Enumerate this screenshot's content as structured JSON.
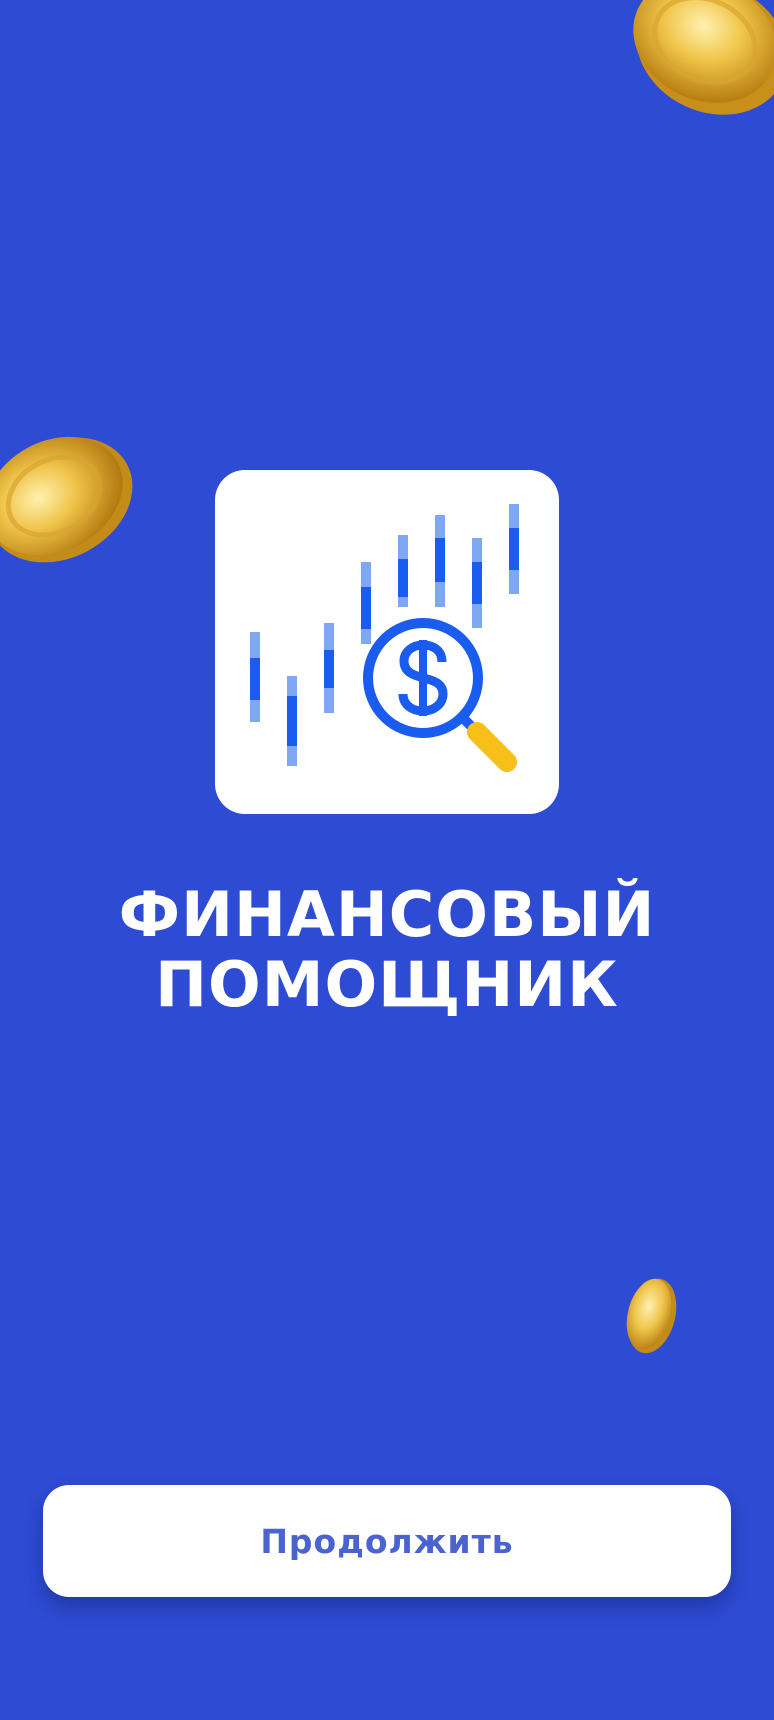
{
  "app": {
    "title_line1": "ФИНАНСОВЫЙ",
    "title_line2": "ПОМОЩНИК",
    "continue_label": "Продолжить"
  },
  "icons": {
    "app_logo": "chart-magnifier-dollar-icon",
    "coin": "gold-coin-icon"
  },
  "colors": {
    "background": "#2e4bd3",
    "button_text": "#4a63cf",
    "chart_dark": "#1a5cf0",
    "chart_light": "#7fa8f3",
    "magnifier_handle": "#f7bf17",
    "coin_gold": "#e8b830"
  }
}
